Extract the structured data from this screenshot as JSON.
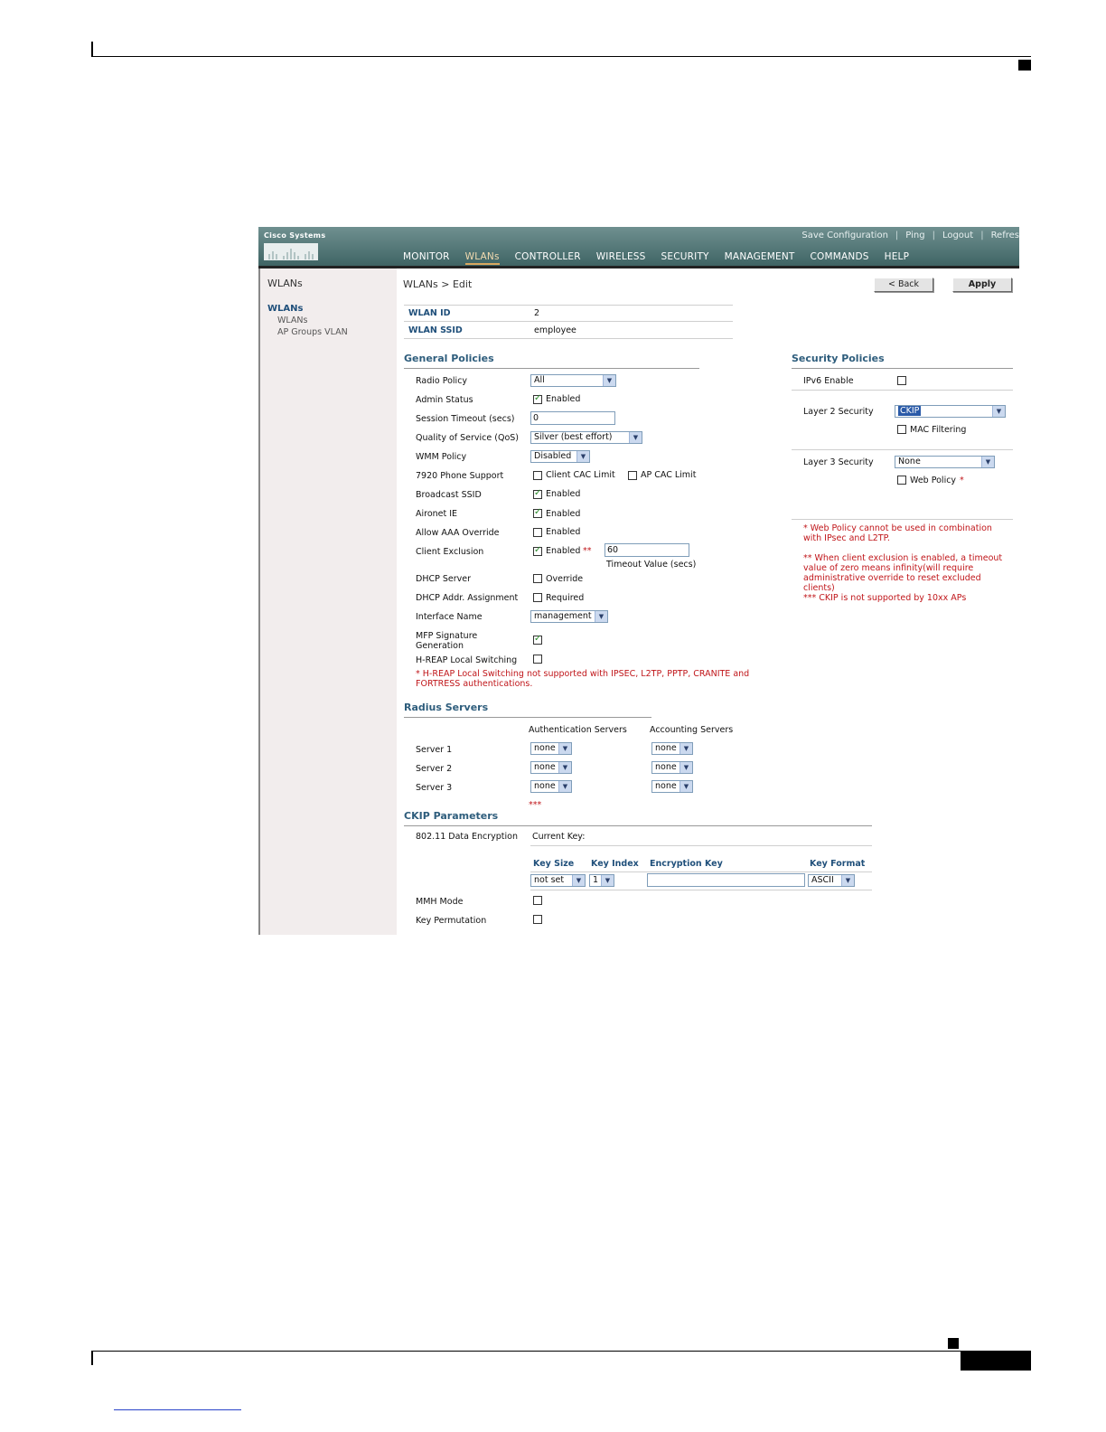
{
  "figure_id": "170053",
  "banner": {
    "logo_text": "Cisco Systems",
    "top_links": [
      "Save Configuration",
      "Ping",
      "Logout",
      "Refres"
    ],
    "nav": [
      "MONITOR",
      "WLANs",
      "CONTROLLER",
      "WIRELESS",
      "SECURITY",
      "MANAGEMENT",
      "COMMANDS",
      "HELP"
    ],
    "active_nav": "WLANs"
  },
  "sidebar": {
    "title": "WLANs",
    "section": "WLANs",
    "items": [
      "WLANs",
      "AP Groups VLAN"
    ]
  },
  "breadcrumb": "WLANs > Edit",
  "buttons": {
    "back": "< Back",
    "apply": "Apply"
  },
  "wlan": {
    "id_label": "WLAN ID",
    "id_value": "2",
    "ssid_label": "WLAN SSID",
    "ssid_value": "employee"
  },
  "general": {
    "title": "General Policies",
    "radio_policy": {
      "label": "Radio Policy",
      "value": "All"
    },
    "admin_status": {
      "label": "Admin Status",
      "option": "Enabled",
      "checked": true
    },
    "session_timeout": {
      "label": "Session Timeout (secs)",
      "value": "0"
    },
    "qos": {
      "label": "Quality of Service (QoS)",
      "value": "Silver (best effort)"
    },
    "wmm": {
      "label": "WMM Policy",
      "value": "Disabled"
    },
    "phone7920": {
      "label": "7920 Phone Support",
      "client_cac": "Client CAC Limit",
      "ap_cac": "AP CAC Limit"
    },
    "broadcast_ssid": {
      "label": "Broadcast SSID",
      "option": "Enabled",
      "checked": true
    },
    "aironet_ie": {
      "label": "Aironet IE",
      "option": "Enabled",
      "checked": true
    },
    "allow_aaa": {
      "label": "Allow AAA Override",
      "option": "Enabled",
      "checked": false
    },
    "client_exclusion": {
      "label": "Client Exclusion",
      "option": "Enabled",
      "stars": "**",
      "timeout_value": "60",
      "timeout_label": "Timeout Value (secs)",
      "checked": true
    },
    "dhcp_server": {
      "label": "DHCP Server",
      "option": "Override",
      "checked": false
    },
    "dhcp_addr": {
      "label": "DHCP Addr. Assignment",
      "option": "Required",
      "checked": false
    },
    "interface": {
      "label": "Interface Name",
      "value": "management"
    },
    "mfp_line1": "MFP Signature",
    "mfp_line2": "Generation",
    "hreap": {
      "label": "H-REAP Local Switching"
    },
    "hreap_note_1": "* H-REAP Local Switching not supported with IPSEC, L2TP, PPTP, CRANITE and",
    "hreap_note_2": "FORTRESS authentications."
  },
  "security": {
    "title": "Security Policies",
    "ipv6": "IPv6 Enable",
    "layer2_label": "Layer 2 Security",
    "layer2_value": "CKIP",
    "mac_filtering": "MAC Filtering",
    "layer3_label": "Layer 3 Security",
    "layer3_value": "None",
    "web_policy": "Web Policy",
    "web_policy_star": "*",
    "notes": [
      "* Web Policy cannot be used in combination",
      "with IPsec and L2TP.",
      "",
      "** When client exclusion is enabled, a timeout",
      "value of zero means infinity(will require",
      "administrative override to reset excluded",
      "clients)",
      "*** CKIP is not supported by 10xx APs"
    ]
  },
  "radius": {
    "title": "Radius Servers",
    "auth_header": "Authentication Servers",
    "acct_header": "Accounting Servers",
    "servers": [
      {
        "label": "Server 1",
        "auth": "none",
        "acct": "none"
      },
      {
        "label": "Server 2",
        "auth": "none",
        "acct": "none"
      },
      {
        "label": "Server 3",
        "auth": "none",
        "acct": "none"
      }
    ]
  },
  "ckip": {
    "stars": "***",
    "title": "CKIP Parameters",
    "encryption_label": "802.11 Data Encryption",
    "current_key": "Current Key:",
    "headers": [
      "Key Size",
      "Key Index",
      "Encryption Key",
      "Key Format"
    ],
    "key_size": "not set",
    "key_index": "1",
    "encryption_key": "",
    "key_format": "ASCII",
    "mmh_mode": "MMH Mode",
    "key_permutation": "Key Permutation"
  }
}
